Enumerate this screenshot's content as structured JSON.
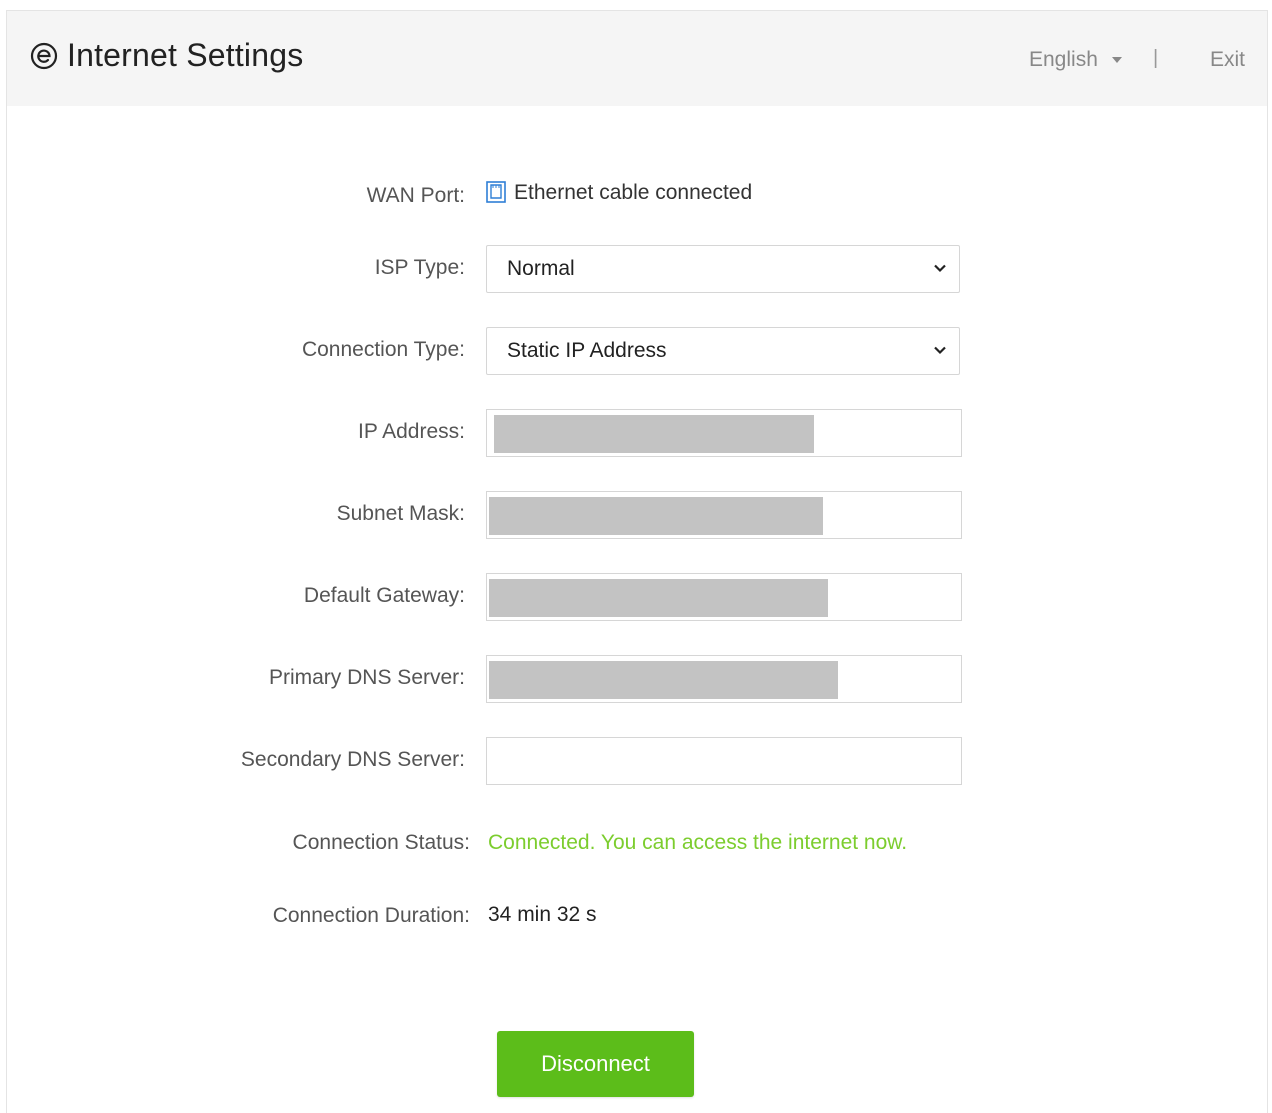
{
  "header": {
    "title": "Internet Settings",
    "language": "English",
    "separator": "|",
    "exit_label": "Exit"
  },
  "form": {
    "wan_port": {
      "label": "WAN Port:",
      "value": "Ethernet cable connected",
      "icon": "ethernet-port-icon"
    },
    "isp_type": {
      "label": "ISP Type:",
      "value": "Normal"
    },
    "connection_type": {
      "label": "Connection Type:",
      "value": "Static IP Address"
    },
    "ip_address": {
      "label": "IP Address:",
      "value": ""
    },
    "subnet_mask": {
      "label": "Subnet Mask:",
      "value": ""
    },
    "default_gateway": {
      "label": "Default Gateway:",
      "value": ""
    },
    "primary_dns": {
      "label": "Primary DNS Server:",
      "value": ""
    },
    "secondary_dns": {
      "label": "Secondary DNS Server:",
      "value": ""
    },
    "connection_status": {
      "label": "Connection Status:",
      "value": "Connected. You can access the internet now."
    },
    "connection_duration": {
      "label": "Connection Duration:",
      "value": "34 min 32 s"
    }
  },
  "actions": {
    "disconnect_label": "Disconnect"
  },
  "colors": {
    "accent_green": "#5cbd1a",
    "status_green": "#7ccd2e",
    "icon_blue": "#2f7fd6",
    "header_bg": "#f5f5f5"
  }
}
